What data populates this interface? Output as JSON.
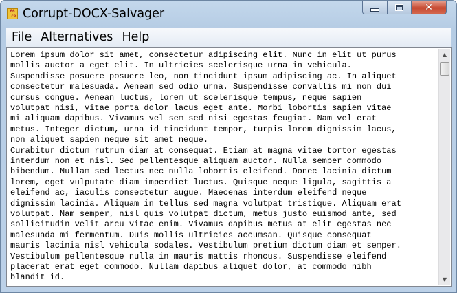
{
  "window": {
    "title": "Corrupt-DOCX-Salvager",
    "icon": "app-document-icon",
    "icon_glyph": "66\n ce"
  },
  "caption": {
    "minimize_icon": "minimize-icon",
    "maximize_icon": "maximize-icon",
    "close_icon": "close-icon",
    "close_glyph": "✕"
  },
  "menu": {
    "items": [
      {
        "label": "File"
      },
      {
        "label": "Alternatives"
      },
      {
        "label": "Help"
      }
    ]
  },
  "editor": {
    "lines": [
      "Lorem ipsum dolor sit amet, consectetur adipiscing elit. Nunc in elit ut purus",
      "mollis auctor a eget elit. In ultricies scelerisque urna in vehicula.",
      "Suspendisse posuere posuere leo, non tincidunt ipsum adipiscing ac. In aliquet",
      "consectetur malesuada. Aenean sed odio urna. Suspendisse convallis mi non dui",
      "cursus congue. Aenean luctus, lorem ut scelerisque tempus, neque sapien",
      "volutpat nisi, vitae porta dolor lacus eget ante. Morbi lobortis sapien vitae",
      "mi aliquam dapibus. Vivamus vel sem sed nisi egestas feugiat. Nam vel erat",
      "metus. Integer dictum, urna id tincidunt tempor, turpis lorem dignissim lacus,",
      "non aliquet sapien neque sit amet neque.",
      "Curabitur dictum rutrum diam at consequat. Etiam at magna vitae tortor egestas",
      "interdum non et nisl. Sed pellentesque aliquam auctor. Nulla semper commodo",
      "bibendum. Nullam sed lectus nec nulla lobortis eleifend. Donec lacinia dictum",
      "lorem, eget vulputate diam imperdiet luctus. Quisque neque ligula, sagittis a",
      "eleifend ac, iaculis consectetur augue. Maecenas interdum eleifend neque",
      "dignissim lacinia. Aliquam in tellus sed magna volutpat tristique. Aliquam erat",
      "volutpat. Nam semper, nisl quis volutpat dictum, metus justo euismod ante, sed",
      "sollicitudin velit arcu vitae enim. Vivamus dapibus metus at elit egestas nec",
      "malesuada mi fermentum. Duis mollis ultricies accumsan. Quisque consequat",
      "mauris lacinia nisl vehicula sodales. Vestibulum pretium dictum diam et semper.",
      "Vestibulum pellentesque nulla in mauris mattis rhoncus. Suspendisse eleifend",
      "placerat erat eget commodo. Nullam dapibus aliquet dolor, at commodo nibh",
      "blandit id."
    ]
  },
  "scrollbar": {
    "up_glyph": "▲",
    "down_glyph": "▼"
  },
  "colors": {
    "frame": "#b5cce4",
    "close_button": "#c74a32"
  }
}
